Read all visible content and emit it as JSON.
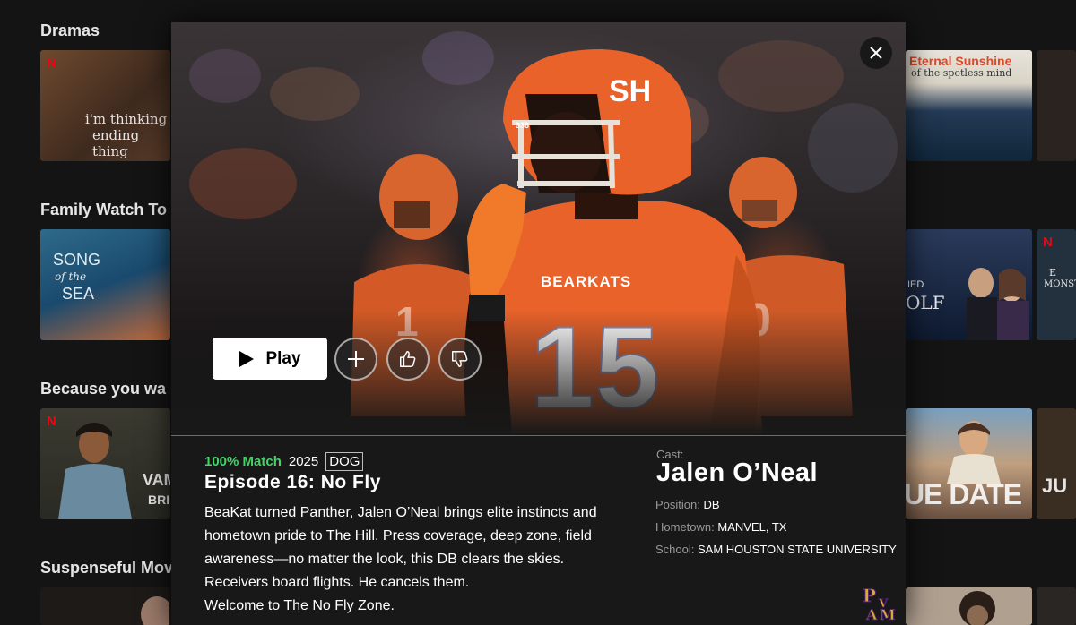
{
  "rows": [
    {
      "title": "Dramas"
    },
    {
      "title": "Family Watch To"
    },
    {
      "title": "Because you wa"
    },
    {
      "title": "Suspenseful Mov"
    }
  ],
  "thumb_texts": {
    "im_thinking": "i'm thinking",
    "ending_thing": "ending thing",
    "eternal_sunshine": "Eternal Sunshine",
    "spotless_mind": "of the spotless mind",
    "song": "SONG",
    "of_the": "of the",
    "sea": "SEA",
    "ied": "IED",
    "olf": "OLF",
    "monst": "MONST",
    "vam": "VAM",
    "bri": "BRI",
    "due_date": "UE DATE",
    "ju": "JU",
    "e": "E",
    "netflix_n": "N"
  },
  "hero": {
    "helmet_logo": "SH",
    "helmet_number": "936",
    "jersey_name": "BEARKATS",
    "jersey_number": "15"
  },
  "actions": {
    "play_label": "Play"
  },
  "meta": {
    "match": "100% Match",
    "year": "2025",
    "rating": "DOG"
  },
  "episode": {
    "title": "Episode 16: No Fly",
    "description_lines": [
      "BeaKat turned Panther, Jalen O’Neal brings elite instincts and",
      "hometown pride to The Hill. Press coverage, deep zone, field",
      "awareness—no matter the look, this DB clears the skies.",
      "Receivers board flights. He cancels them.",
      "Welcome to The No Fly Zone."
    ]
  },
  "cast": {
    "label": "Cast:",
    "name": "Jalen O’Neal",
    "position_label": "Position:",
    "position": "DB",
    "hometown_label": "Hometown:",
    "hometown": "MANVEL, TX",
    "school_label": "School:",
    "school": "SAM HOUSTON STATE UNIVERSITY"
  },
  "logo": {
    "letters": "PVAM"
  },
  "colors": {
    "match_green": "#46d369",
    "netflix_red": "#e50914",
    "jersey_orange": "#e8622a",
    "pvam_gold": "#e0a92a",
    "pvam_purple": "#4b2070"
  }
}
